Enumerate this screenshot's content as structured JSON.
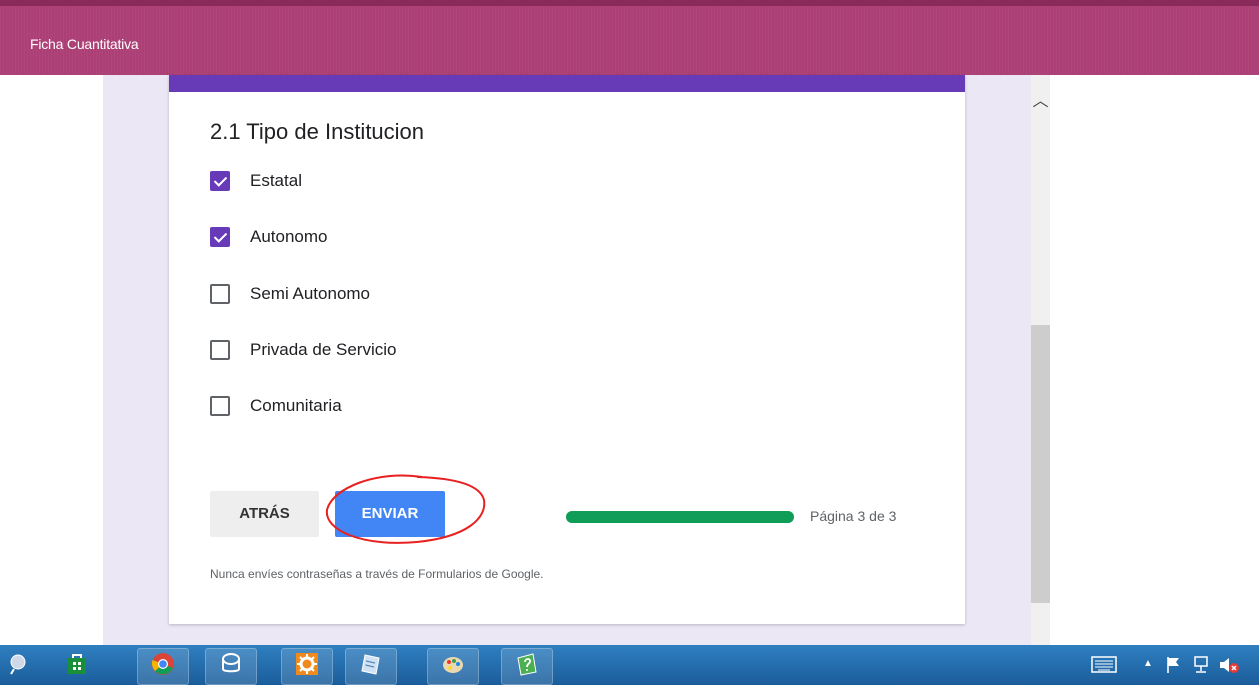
{
  "header": {
    "title": "Ficha Cuantitativa"
  },
  "form": {
    "question": "2.1 Tipo de Institucion",
    "options": [
      {
        "label": "Estatal",
        "checked": true
      },
      {
        "label": "Autonomo",
        "checked": true
      },
      {
        "label": "Semi Autonomo",
        "checked": false
      },
      {
        "label": "Privada de Servicio",
        "checked": false
      },
      {
        "label": "Comunitaria",
        "checked": false
      }
    ],
    "back_label": "ATRÁS",
    "send_label": "ENVIAR",
    "progress": 1.0,
    "page_indicator": "Página 3 de 3",
    "footer_note": "Nunca envíes contraseñas a través de Formularios de Google."
  },
  "colors": {
    "header": "#ac3f75",
    "accent": "#673ab7",
    "send_button": "#4285f4",
    "progress": "#0f9d58",
    "annotation": "#e8201f"
  },
  "taskbar": {
    "icons": [
      "start-icon",
      "store-icon",
      "chrome-icon",
      "database-icon",
      "settings-icon",
      "notes-icon",
      "paint-icon",
      "help-icon"
    ],
    "tray_icons": [
      "keyboard-icon",
      "chevron-up-icon",
      "flag-icon",
      "network-icon",
      "volume-muted-icon"
    ]
  }
}
